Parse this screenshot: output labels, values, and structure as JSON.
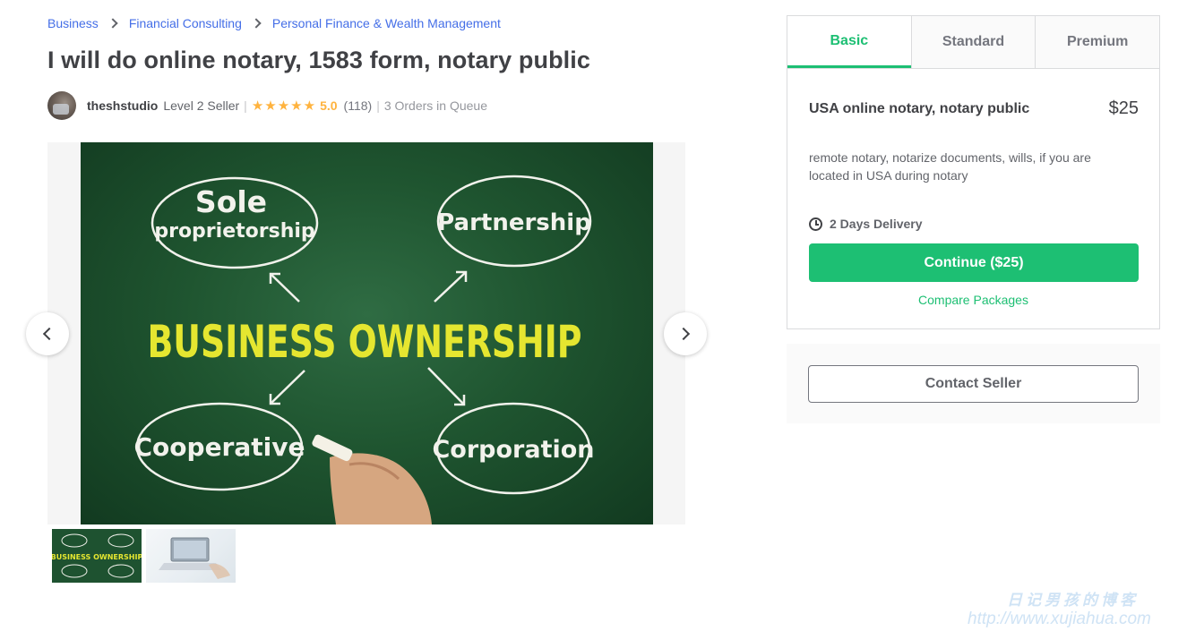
{
  "breadcrumb": [
    "Business",
    "Financial Consulting",
    "Personal Finance & Wealth Management"
  ],
  "title": "I will do online notary, 1583 form, notary public",
  "seller": {
    "name": "theshstudio",
    "level": "Level 2 Seller",
    "separator": "|",
    "stars": "★★★★★",
    "rating": "5.0",
    "reviews": "(118)",
    "queue": "3 Orders in Queue"
  },
  "gallery": {
    "main_image": {
      "headline": "BUSINESS OWNERSHIP",
      "nodes": [
        "Sole",
        "proprietorship",
        "Partnership",
        "Cooperative",
        "Corporation"
      ]
    },
    "thumbnails": [
      "business-ownership-thumbnail",
      "laptop-thumbnail"
    ],
    "thumb_headline": "BUSINESS OWNERSHIP"
  },
  "packages": {
    "tabs": [
      "Basic",
      "Standard",
      "Premium"
    ],
    "active_tab": "Basic",
    "name": "USA online notary, notary public",
    "price": "$25",
    "description": "remote notary, notarize documents, wills, if you are located in USA during notary",
    "delivery": "2 Days Delivery",
    "continue_label": "Continue ($25)",
    "compare_label": "Compare Packages"
  },
  "contact": {
    "label": "Contact Seller"
  },
  "watermark": {
    "line1": "日记男孩的博客",
    "line2": "http://www.xujiahua.com"
  },
  "colors": {
    "accent": "#1dbf73",
    "link": "#446ee7",
    "star": "#ffb33e",
    "chalkboard": "#1f5530",
    "chalk_yellow": "#e5e630"
  }
}
